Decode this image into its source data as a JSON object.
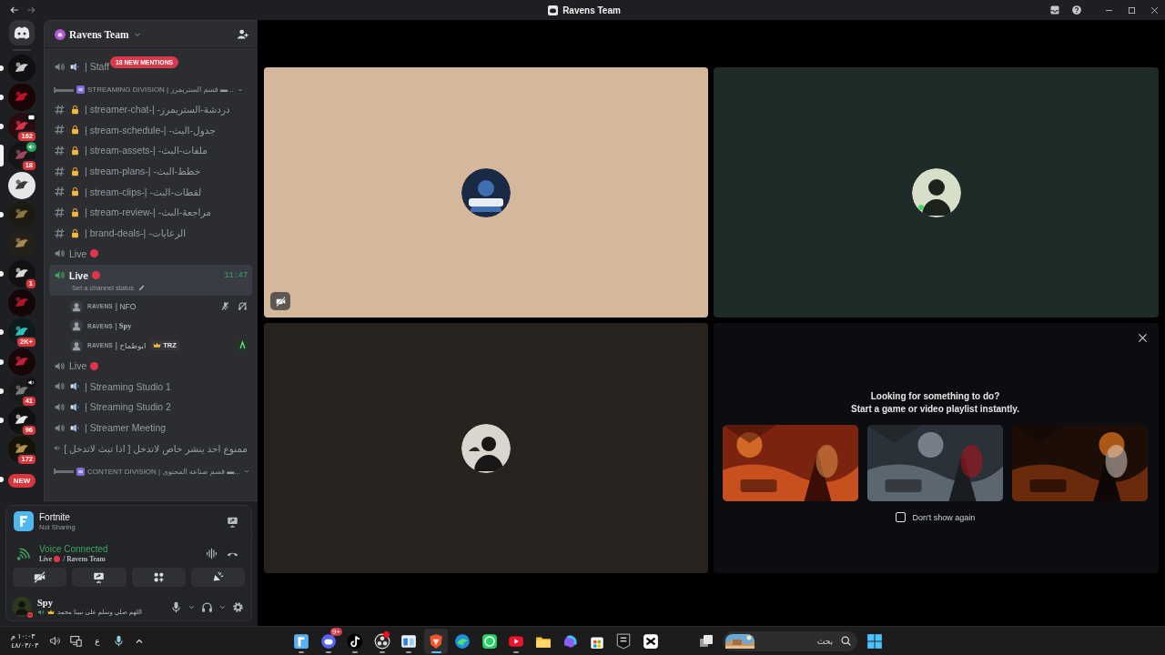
{
  "window": {
    "title": "Ravens Team"
  },
  "servers": [
    {
      "unread": true,
      "selected": false
    },
    {
      "unread": true,
      "selected": false
    },
    {
      "unread": true,
      "selected": false,
      "badge": "162",
      "screen_sharing": true
    },
    {
      "unread": false,
      "selected": true,
      "badge": "18",
      "in_voice": true
    },
    {
      "unread": false,
      "selected": false
    },
    {
      "unread": true,
      "selected": false
    },
    {
      "unread": false,
      "selected": false
    },
    {
      "unread": true,
      "selected": false,
      "badge": "1"
    },
    {
      "unread": false,
      "selected": false
    },
    {
      "unread": true,
      "selected": false,
      "badge": "2K+"
    },
    {
      "unread": true,
      "selected": false
    },
    {
      "unread": true,
      "selected": false,
      "badge": "41",
      "audio": true
    },
    {
      "unread": true,
      "selected": false,
      "badge": "96"
    },
    {
      "unread": false,
      "selected": false,
      "badge": "172"
    },
    {
      "unread": true,
      "selected": false,
      "badge": "NEW",
      "kind": "new"
    }
  ],
  "sidebar": {
    "server_name": "Ravens Team",
    "mentions_pill": "18 NEW MENTIONS",
    "channels": [
      {
        "kind": "voice",
        "name": "| Staff",
        "speaker": true,
        "selected": false
      },
      {
        "kind": "category",
        "name": "STREAMING DIVISION | قسم الستريمرز ▬..."
      },
      {
        "kind": "text",
        "name": "| streamer-chat-| -دردشة-الستريمرز",
        "locked": true,
        "selected": false
      },
      {
        "kind": "text",
        "name": "| stream-schedule-| -جدول-البث",
        "locked": true,
        "selected": false
      },
      {
        "kind": "text",
        "name": "| stream-assets-| -ملفات-البث",
        "locked": true,
        "selected": false
      },
      {
        "kind": "text",
        "name": "| stream-plans-| -خطط-البث",
        "locked": true,
        "selected": false
      },
      {
        "kind": "text",
        "name": "| stream-clips-| -لقطات-البث",
        "locked": true,
        "selected": false
      },
      {
        "kind": "text",
        "name": "| stream-review-| -مراجعة-البث",
        "locked": true,
        "selected": false
      },
      {
        "kind": "text",
        "name": "| brand-deals-| -الرعايات",
        "locked": true,
        "selected": false
      },
      {
        "kind": "voice",
        "name": "Live",
        "live_dot": true,
        "selected": false
      },
      {
        "kind": "voice",
        "name": "Live",
        "live_dot": true,
        "selected": true,
        "time": "11:47",
        "status": "Set a channel status"
      },
      {
        "kind": "member",
        "prefix": "RAVENS",
        "name": "| NFO",
        "muted": true,
        "deafened": true
      },
      {
        "kind": "member",
        "prefix": "RAVENS",
        "name": "| Spy",
        "fancy": true
      },
      {
        "kind": "member",
        "prefix": "RAVENS",
        "name": "| ابوطماح",
        "tag": "TRZ",
        "activity": true
      },
      {
        "kind": "voice",
        "name": "Live",
        "live_dot": true,
        "selected": false
      },
      {
        "kind": "voice",
        "name": "| Streaming Studio 1",
        "speaker": true,
        "selected": false
      },
      {
        "kind": "voice",
        "name": "| Streaming Studio 2",
        "speaker": true,
        "selected": false
      },
      {
        "kind": "voice",
        "name": "| Streamer Meeting",
        "speaker": true,
        "selected": false
      },
      {
        "kind": "voice",
        "name": "ممنوع احد ينشر خاص لاتدخل [ اذا تبث لاتدخل ]",
        "selected": false
      },
      {
        "kind": "category",
        "name": "CONTENT DIVISION | قسم صناعة المحتوى ▬..."
      }
    ]
  },
  "panel": {
    "game": {
      "name": "Fortnite",
      "status": "Not Sharing"
    },
    "voice": {
      "title": "Voice Connected",
      "channel": "Live",
      "live_dot": true,
      "server": "/ Ravens Team"
    },
    "user": {
      "name": "Spy",
      "status": "اللهم صلي وسلم على نبينا محمد"
    }
  },
  "stage": {
    "tiles": [
      {
        "color": "#d5b89c",
        "video_off": true
      },
      {
        "color": "#1f2b28",
        "video_off": false
      },
      {
        "color": "#28231f",
        "video_off": false
      }
    ],
    "promo": {
      "title": "Looking for something to do?",
      "subtitle": "Start a game or video playlist instantly.",
      "dont_show": {
        "label": "Don't show again",
        "checked": false
      }
    }
  },
  "taskbar": {
    "time": "١٠:٠٣ م",
    "date": "٤٨/٠٣/٠٣",
    "language": "ع",
    "search_placeholder": "بحث",
    "apps": [
      {
        "kind": "f-tile",
        "running": true,
        "selected": false
      },
      {
        "kind": "chat",
        "running": true,
        "selected": false,
        "badge": "9+"
      },
      {
        "kind": "note",
        "running": true,
        "selected": false
      },
      {
        "kind": "recorder",
        "running": true,
        "selected": false,
        "alert": true
      },
      {
        "kind": "window",
        "running": true,
        "selected": false
      },
      {
        "kind": "lion",
        "running": true,
        "selected": true
      },
      {
        "kind": "wave",
        "running": false,
        "selected": false
      },
      {
        "kind": "phone",
        "running": false,
        "selected": false
      },
      {
        "kind": "play",
        "running": true,
        "selected": false
      },
      {
        "kind": "folder",
        "running": false,
        "selected": false
      },
      {
        "kind": "swirl",
        "running": false,
        "selected": false
      },
      {
        "kind": "bag",
        "running": false,
        "selected": false
      },
      {
        "kind": "epic",
        "running": false,
        "selected": false
      },
      {
        "kind": "scissors",
        "running": false,
        "selected": false
      }
    ]
  }
}
